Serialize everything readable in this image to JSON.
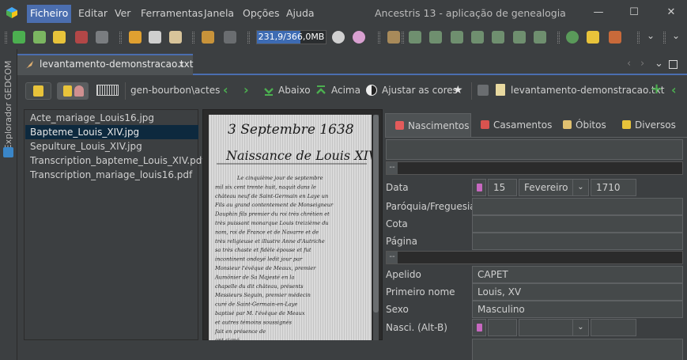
{
  "titlebar": {
    "title": "Ancestris 13 - aplicação de genealogia",
    "menus": [
      "Ficheiro",
      "Editar",
      "Ver",
      "Ferramentas",
      "Janela",
      "Opções",
      "Ajuda"
    ],
    "active_menu": "Ficheiro",
    "window_buttons": {
      "minimize": "—",
      "maximize": "☐",
      "close": "✕"
    }
  },
  "toolbar": {
    "memory_text": "231,9/366,0MB",
    "memory_fraction": 0.63
  },
  "left_strip": {
    "explorer_label": "Explorador GEDCOM"
  },
  "document_tab": {
    "label": "levantamento-demonstracao.txt",
    "close": "x"
  },
  "tab_nav": {
    "prev": "‹",
    "next": "›",
    "menu": "⌄"
  },
  "doc_toolbar": {
    "folder_path": "gen-bourbon\\actes",
    "down_label": "Abaixo",
    "up_label": "Acima",
    "adjust_colors_label": "Ajustar as cores",
    "file_label": "levantamento-demonstracao.txt"
  },
  "file_list": {
    "items": [
      "Acte_mariage_Louis16.jpg",
      "Bapteme_Louis_XIV.jpg",
      "Sepulture_Louis_XIV.jpg",
      "Transcription_bapteme_Louis_XIV.pdf",
      "Transcription_mariage_louis16.pdf"
    ],
    "selected_index": 1
  },
  "manuscript": {
    "date_heading": "3 Septembre 1638",
    "title": "Naissance de Louis XIV",
    "lines": [
      "Le cinquième jour de septembre",
      "mil six cent trente huit, naquit dans le",
      "château neuf de Saint-Germain en Laye un",
      "Fils au grand contentement de Monseigneur",
      "Dauphin fils premier du roi très chrétien et",
      "très puissant monarque Louis treizième du",
      "nom, roi de France et de Navarre et de",
      "très religieuse et illustre Anne d'Autriche",
      "sa très chaste et fidèle épouse et fut",
      "incontinent ondoyé ledit jour par",
      "Monsieur l'évêque de Meaux, premier",
      "Aumônier de Sa Majesté en la",
      "chapelle du dit château, présents",
      "Messieurs Seguin, premier médecin",
      "curé de Saint-Germain-en-Laye",
      "baptisé par M. l'évêque de Meaux",
      "et autres témoins soussignés",
      "fait en présence de",
      "ont signé"
    ]
  },
  "form_tabs": [
    {
      "label": "Nascimentos",
      "icon": "births-icon",
      "color": "#e35b5b"
    },
    {
      "label": "Casamentos",
      "icon": "marriages-icon",
      "color": "#d9534f"
    },
    {
      "label": "Óbitos",
      "icon": "deaths-icon",
      "color": "#e0c070"
    },
    {
      "label": "Diversos",
      "icon": "misc-icon",
      "color": "#e8c33a"
    }
  ],
  "form": {
    "collapse_label": "--",
    "date_label": "Data",
    "day": "15",
    "month": "Fevereiro",
    "year": "1710",
    "parish_label": "Paróquia/Freguesia",
    "parish_value": "",
    "cote_label": "Cota",
    "cote_value": "",
    "page_label": "Página",
    "page_value": "",
    "surname_label": "Apelido",
    "surname_value": "CAPET",
    "firstname_label": "Primeiro nome",
    "firstname_value": "Louis, XV",
    "sex_label": "Sexo",
    "sex_value": "Masculino",
    "birth_label": "Nasci. (Alt-B)",
    "birth_day": "",
    "birth_month": "",
    "birth_year": ""
  },
  "colors": {
    "accent": "#4b6eaf",
    "selected_row": "#0d293e",
    "background": "#3c3f41",
    "panel": "#45494a"
  }
}
